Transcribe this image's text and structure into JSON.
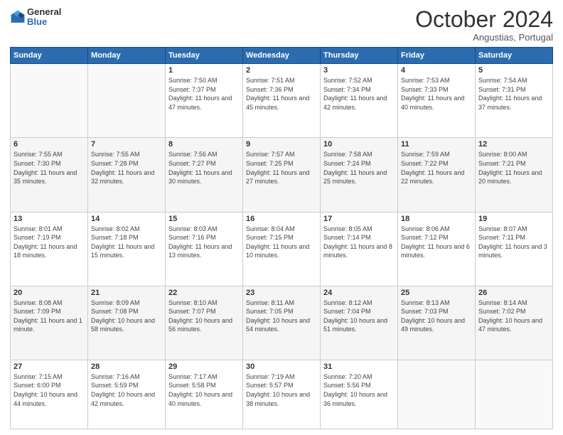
{
  "header": {
    "logo_general": "General",
    "logo_blue": "Blue",
    "month": "October 2024",
    "location": "Angustias, Portugal"
  },
  "weekdays": [
    "Sunday",
    "Monday",
    "Tuesday",
    "Wednesday",
    "Thursday",
    "Friday",
    "Saturday"
  ],
  "rows": [
    [
      {
        "day": "",
        "info": ""
      },
      {
        "day": "",
        "info": ""
      },
      {
        "day": "1",
        "info": "Sunrise: 7:50 AM\nSunset: 7:37 PM\nDaylight: 11 hours and 47 minutes."
      },
      {
        "day": "2",
        "info": "Sunrise: 7:51 AM\nSunset: 7:36 PM\nDaylight: 11 hours and 45 minutes."
      },
      {
        "day": "3",
        "info": "Sunrise: 7:52 AM\nSunset: 7:34 PM\nDaylight: 11 hours and 42 minutes."
      },
      {
        "day": "4",
        "info": "Sunrise: 7:53 AM\nSunset: 7:33 PM\nDaylight: 11 hours and 40 minutes."
      },
      {
        "day": "5",
        "info": "Sunrise: 7:54 AM\nSunset: 7:31 PM\nDaylight: 11 hours and 37 minutes."
      }
    ],
    [
      {
        "day": "6",
        "info": "Sunrise: 7:55 AM\nSunset: 7:30 PM\nDaylight: 11 hours and 35 minutes."
      },
      {
        "day": "7",
        "info": "Sunrise: 7:55 AM\nSunset: 7:28 PM\nDaylight: 11 hours and 32 minutes."
      },
      {
        "day": "8",
        "info": "Sunrise: 7:56 AM\nSunset: 7:27 PM\nDaylight: 11 hours and 30 minutes."
      },
      {
        "day": "9",
        "info": "Sunrise: 7:57 AM\nSunset: 7:25 PM\nDaylight: 11 hours and 27 minutes."
      },
      {
        "day": "10",
        "info": "Sunrise: 7:58 AM\nSunset: 7:24 PM\nDaylight: 11 hours and 25 minutes."
      },
      {
        "day": "11",
        "info": "Sunrise: 7:59 AM\nSunset: 7:22 PM\nDaylight: 11 hours and 22 minutes."
      },
      {
        "day": "12",
        "info": "Sunrise: 8:00 AM\nSunset: 7:21 PM\nDaylight: 11 hours and 20 minutes."
      }
    ],
    [
      {
        "day": "13",
        "info": "Sunrise: 8:01 AM\nSunset: 7:19 PM\nDaylight: 11 hours and 18 minutes."
      },
      {
        "day": "14",
        "info": "Sunrise: 8:02 AM\nSunset: 7:18 PM\nDaylight: 11 hours and 15 minutes."
      },
      {
        "day": "15",
        "info": "Sunrise: 8:03 AM\nSunset: 7:16 PM\nDaylight: 11 hours and 13 minutes."
      },
      {
        "day": "16",
        "info": "Sunrise: 8:04 AM\nSunset: 7:15 PM\nDaylight: 11 hours and 10 minutes."
      },
      {
        "day": "17",
        "info": "Sunrise: 8:05 AM\nSunset: 7:14 PM\nDaylight: 11 hours and 8 minutes."
      },
      {
        "day": "18",
        "info": "Sunrise: 8:06 AM\nSunset: 7:12 PM\nDaylight: 11 hours and 6 minutes."
      },
      {
        "day": "19",
        "info": "Sunrise: 8:07 AM\nSunset: 7:11 PM\nDaylight: 11 hours and 3 minutes."
      }
    ],
    [
      {
        "day": "20",
        "info": "Sunrise: 8:08 AM\nSunset: 7:09 PM\nDaylight: 11 hours and 1 minute."
      },
      {
        "day": "21",
        "info": "Sunrise: 8:09 AM\nSunset: 7:08 PM\nDaylight: 10 hours and 58 minutes."
      },
      {
        "day": "22",
        "info": "Sunrise: 8:10 AM\nSunset: 7:07 PM\nDaylight: 10 hours and 56 minutes."
      },
      {
        "day": "23",
        "info": "Sunrise: 8:11 AM\nSunset: 7:05 PM\nDaylight: 10 hours and 54 minutes."
      },
      {
        "day": "24",
        "info": "Sunrise: 8:12 AM\nSunset: 7:04 PM\nDaylight: 10 hours and 51 minutes."
      },
      {
        "day": "25",
        "info": "Sunrise: 8:13 AM\nSunset: 7:03 PM\nDaylight: 10 hours and 49 minutes."
      },
      {
        "day": "26",
        "info": "Sunrise: 8:14 AM\nSunset: 7:02 PM\nDaylight: 10 hours and 47 minutes."
      }
    ],
    [
      {
        "day": "27",
        "info": "Sunrise: 7:15 AM\nSunset: 6:00 PM\nDaylight: 10 hours and 44 minutes."
      },
      {
        "day": "28",
        "info": "Sunrise: 7:16 AM\nSunset: 5:59 PM\nDaylight: 10 hours and 42 minutes."
      },
      {
        "day": "29",
        "info": "Sunrise: 7:17 AM\nSunset: 5:58 PM\nDaylight: 10 hours and 40 minutes."
      },
      {
        "day": "30",
        "info": "Sunrise: 7:19 AM\nSunset: 5:57 PM\nDaylight: 10 hours and 38 minutes."
      },
      {
        "day": "31",
        "info": "Sunrise: 7:20 AM\nSunset: 5:56 PM\nDaylight: 10 hours and 36 minutes."
      },
      {
        "day": "",
        "info": ""
      },
      {
        "day": "",
        "info": ""
      }
    ]
  ]
}
